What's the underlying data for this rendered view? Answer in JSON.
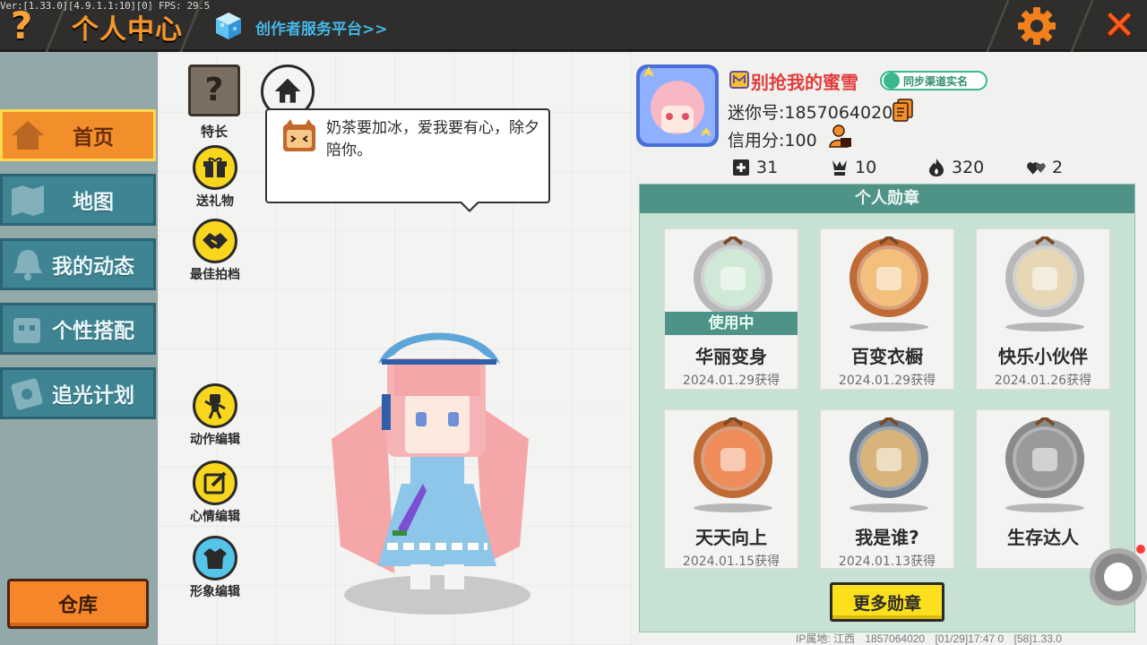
{
  "header": {
    "version_text": "Ver:[1.33.0][4.9.1.1:10][0] FPS: 29.5",
    "help_icon_text": "?",
    "title": "个人中心",
    "creator_link": "创作者服务平台>>",
    "close_icon_text": "✕"
  },
  "sidebar": {
    "items": [
      {
        "label": "首页",
        "icon": "house-icon",
        "active": true
      },
      {
        "label": "地图",
        "icon": "map-icon",
        "active": false
      },
      {
        "label": "我的动态",
        "icon": "bell-icon",
        "active": false
      },
      {
        "label": "个性搭配",
        "icon": "outfit-icon",
        "active": false
      },
      {
        "label": "追光计划",
        "icon": "light-plan-icon",
        "active": false
      }
    ],
    "warehouse_label": "仓库"
  },
  "center": {
    "skill_icon_text": "?",
    "skill_label": "特长",
    "bubble_text": "奶茶要加冰，爱我要有心，除夕陪你。",
    "actions_top": [
      {
        "label": "送礼物",
        "icon": "gift-icon"
      },
      {
        "label": "最佳拍档",
        "icon": "handshake-icon"
      }
    ],
    "actions_bottom": [
      {
        "label": "动作编辑",
        "icon": "pose-icon"
      },
      {
        "label": "心情编辑",
        "icon": "edit-icon"
      },
      {
        "label": "形象编辑",
        "icon": "costume-icon"
      }
    ]
  },
  "profile": {
    "nickname": "别抢我的蜜雪",
    "realname_badge": "同步渠道实名",
    "mini_id": "迷你号:1857064020",
    "credit": "信用分:100",
    "stats": [
      {
        "icon": "plus-square-icon",
        "value": "31"
      },
      {
        "icon": "trophy-person-icon",
        "value": "10"
      },
      {
        "icon": "flame-icon",
        "value": "320"
      },
      {
        "icon": "hearts-icon",
        "value": "2"
      }
    ]
  },
  "medals": {
    "header": "个人勋章",
    "items": [
      {
        "name": "华丽变身",
        "date": "2024.01.29获得",
        "in_use": true,
        "in_use_label": "使用中",
        "frame": "#b8b8b8",
        "fill": "#cfe9d6",
        "icon": "transform-medal-icon"
      },
      {
        "name": "百变衣橱",
        "date": "2024.01.29获得",
        "in_use": false,
        "frame": "#c06a35",
        "fill": "#f2c07c",
        "icon": "wardrobe-medal-icon"
      },
      {
        "name": "快乐小伙伴",
        "date": "2024.01.26获得",
        "in_use": false,
        "frame": "#b8b8b8",
        "fill": "#e7d7b5",
        "icon": "friends-medal-icon"
      },
      {
        "name": "天天向上",
        "date": "2024.01.15获得",
        "in_use": false,
        "frame": "#c06a35",
        "fill": "#f08b5a",
        "icon": "calendar-medal-icon"
      },
      {
        "name": "我是谁?",
        "date": "2024.01.13获得",
        "in_use": false,
        "frame": "#6a7a8a",
        "fill": "#d8b37a",
        "icon": "idcard-medal-icon"
      },
      {
        "name": "生存达人",
        "date": "",
        "in_use": false,
        "frame": "#8a8a8a",
        "fill": "#9a9a9a",
        "icon": "campfire-medal-icon"
      }
    ],
    "more_label": "更多勋章"
  },
  "footer": {
    "ip_location": "IP属地: 江西",
    "user_id": "1857064020",
    "time": "[01/29]17:47 0",
    "build": "[58]1.33.0"
  },
  "colors": {
    "accent_orange": "#f28f2a",
    "nav_teal": "#3f8493",
    "medal_panel": "#c7e2d2",
    "medal_header": "#4f9287",
    "nickname_red": "#e23c3c",
    "button_yellow": "#fde01d"
  }
}
